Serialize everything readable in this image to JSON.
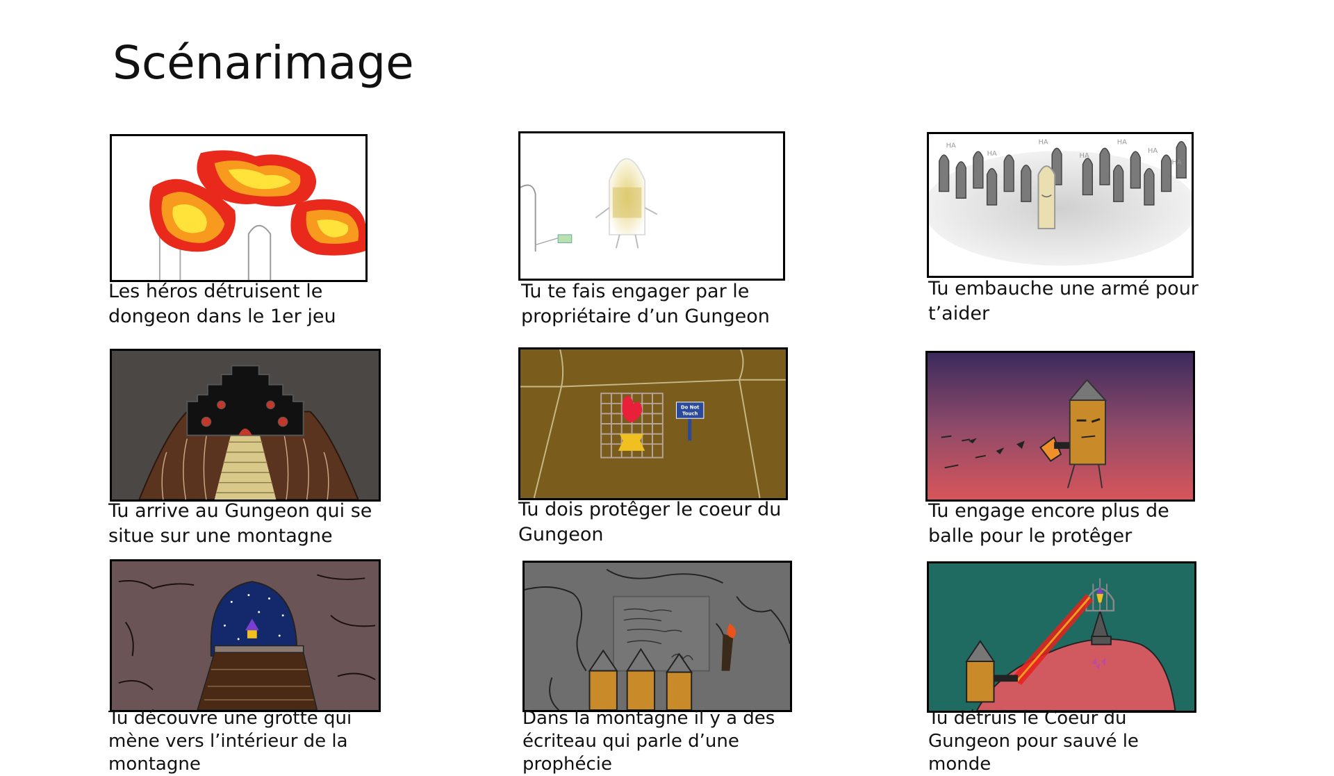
{
  "title": "Scénarimage",
  "panels": [
    {
      "caption": "Les héros détruisent le dongeon dans le 1er jeu"
    },
    {
      "caption": "Tu te fais engager par le propriétaire d’un Gungeon"
    },
    {
      "caption": "Tu embauche une armé pour t’aider"
    },
    {
      "caption": "Tu arrive au Gungeon qui se situe sur une montagne"
    },
    {
      "caption": "Tu dois protêger le coeur du Gungeon"
    },
    {
      "caption": "Tu engage encore plus de balle pour le protêger"
    },
    {
      "caption": "Tu découvre une grotte qui mène vers l’intérieur de la montagne"
    },
    {
      "caption": "Dans la montagne il y a des écriteau qui parle d’une prophécie"
    },
    {
      "caption": "Tu détruis le Coeur du Gungeon pour sauvé le monde"
    }
  ],
  "sign_text": [
    "Do Not",
    "Touch"
  ],
  "laughs": [
    "HA",
    "HA",
    "HA",
    "HA",
    "HA",
    "HA",
    "HA"
  ],
  "colors": {
    "fire_outer": "#e8291c",
    "fire_mid": "#f79a1e",
    "fire_inner": "#ffe23a",
    "castle_bg": "#4a4745",
    "mountain": "#5b3420",
    "room_floor": "#7a5c1c",
    "sunset_top": "#3b2a5c",
    "sunset_bottom": "#d8555a",
    "cave": "#6b5455",
    "stone": "#6e6e6e",
    "teal": "#1f6b62",
    "bullet": "#c98a2a"
  }
}
